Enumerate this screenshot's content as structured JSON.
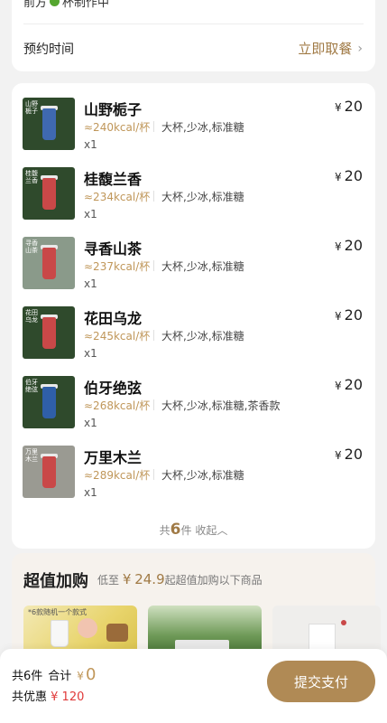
{
  "top_card": {
    "queue_prefix": "前方",
    "queue_suffix": "杯制作中",
    "reserve_label": "预约时间",
    "reserve_action": "立即取餐",
    "chevron": "›"
  },
  "items": [
    {
      "name": "山野栀子",
      "kcal": "≈240kcal/杯",
      "spec": "大杯,少冰,标准糖",
      "qty": "x1",
      "currency": "¥",
      "price": "20",
      "thumb_mark": "山野栀子",
      "thumb_bg": "#2f4a2c",
      "cup_color": "#3f69b0"
    },
    {
      "name": "桂馥兰香",
      "kcal": "≈234kcal/杯",
      "spec": "大杯,少冰,标准糖",
      "qty": "x1",
      "currency": "¥",
      "price": "20",
      "thumb_mark": "桂馥兰香",
      "thumb_bg": "#2f4a2c",
      "cup_color": "#c94848"
    },
    {
      "name": "寻香山茶",
      "kcal": "≈237kcal/杯",
      "spec": "大杯,少冰,标准糖",
      "qty": "x1",
      "currency": "¥",
      "price": "20",
      "thumb_mark": "寻香山茶",
      "thumb_bg": "#8a9a8a",
      "cup_color": "#c94848"
    },
    {
      "name": "花田乌龙",
      "kcal": "≈245kcal/杯",
      "spec": "大杯,少冰,标准糖",
      "qty": "x1",
      "currency": "¥",
      "price": "20",
      "thumb_mark": "花田乌龙",
      "thumb_bg": "#2f4a2c",
      "cup_color": "#c94848"
    },
    {
      "name": "伯牙绝弦",
      "kcal": "≈268kcal/杯",
      "spec": "大杯,少冰,标准糖,茶香款",
      "qty": "x1",
      "currency": "¥",
      "price": "20",
      "thumb_mark": "伯牙绝弦",
      "thumb_bg": "#2f4a2c",
      "cup_color": "#2f5fa8"
    },
    {
      "name": "万里木兰",
      "kcal": "≈289kcal/杯",
      "spec": "大杯,少冰,标准糖",
      "qty": "x1",
      "currency": "¥",
      "price": "20",
      "thumb_mark": "万里木兰",
      "thumb_bg": "#9a9a92",
      "cup_color": "#c94848"
    }
  ],
  "summary": {
    "prefix": "共",
    "count": "6",
    "suffix": "件",
    "collapse": "收起",
    "caret": "︿"
  },
  "addon": {
    "title": "超值加购",
    "sub_prefix": "低至",
    "currency": "¥",
    "price": "24.9",
    "sub_suffix": "起超值加购以下商品",
    "promo_text": "*6款随机一个款式"
  },
  "bottom": {
    "count_text": "共6件",
    "total_label": "合计",
    "currency": "¥",
    "total_amount": "0",
    "discount_label": "共优惠",
    "discount_amount": "¥ 120",
    "pay_button": "提交支付"
  },
  "colors": {
    "accent": "#a07a45",
    "pay_button": "#b08a55",
    "discount": "#e03a3a",
    "queue_dot": "#55a630"
  }
}
